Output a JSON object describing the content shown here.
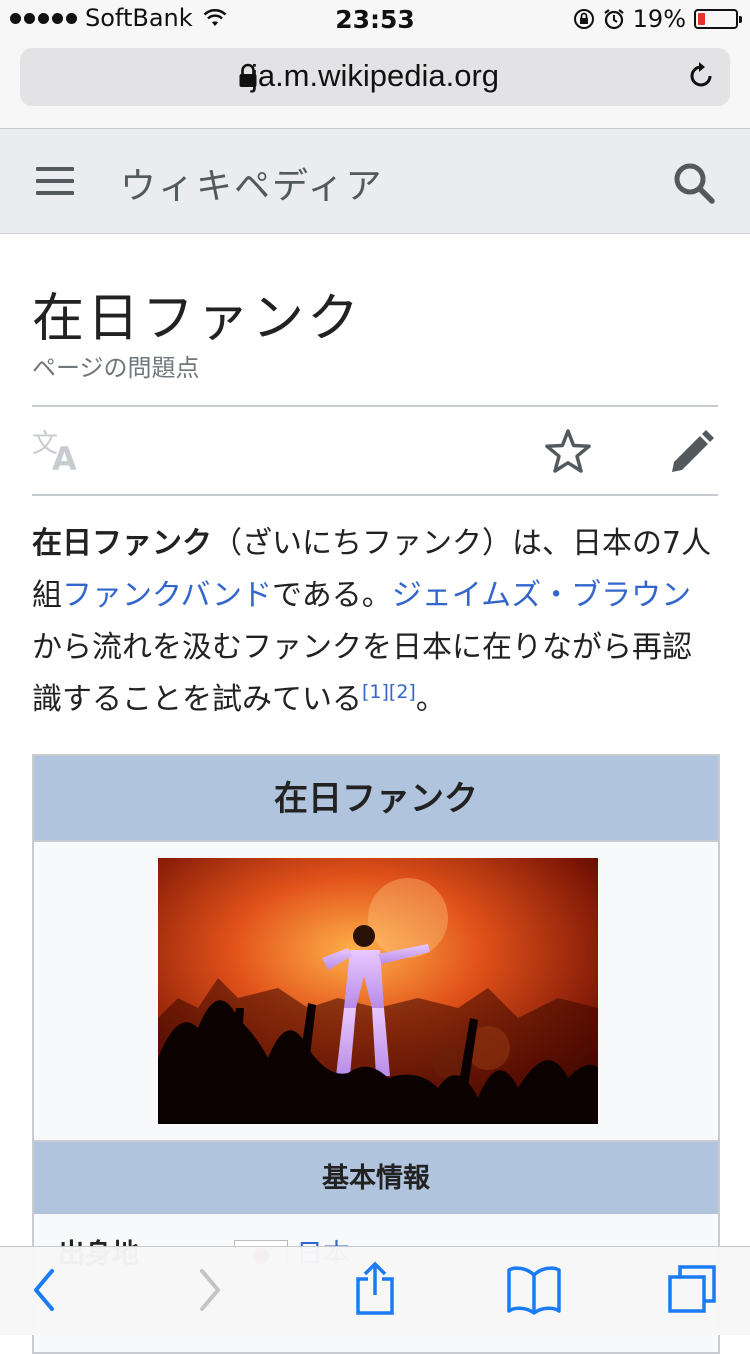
{
  "status_bar": {
    "carrier": "SoftBank",
    "time": "23:53",
    "battery_percent": "19%",
    "battery_level": 0.19,
    "battery_color": "#e8332c"
  },
  "browser": {
    "url": "ja.m.wikipedia.org",
    "lock_icon": "lock-icon",
    "reload_icon": "reload-icon"
  },
  "wiki_header": {
    "title": "ウィキペディア",
    "menu_icon": "hamburger-menu-icon",
    "search_icon": "search-icon"
  },
  "article": {
    "title": "在日ファンク",
    "issues_link": "ページの問題点",
    "actions": [
      "language-icon",
      "watch-star-icon",
      "edit-pencil-icon"
    ],
    "intro": {
      "bold": "在日ファンク",
      "t1": "（ざいにちファンク）は、日本の7人組",
      "link1": "ファンクバンド",
      "t2": "である。",
      "link2": "ジェイムズ・ブラウン",
      "t3": "から流れを汲むファンクを日本に在りながら再認識することを試みている",
      "ref1": "[1]",
      "ref2": "[2]",
      "t4": "。"
    }
  },
  "infobox": {
    "title": "在日ファンク",
    "subheader": "基本情報",
    "row_label": "出身地",
    "row_value": "日本",
    "header_color": "#b0c4de"
  },
  "toolbar": {
    "icons": [
      "back-icon",
      "forward-icon",
      "share-icon",
      "bookmarks-icon",
      "tabs-icon"
    ],
    "accent": "#1a7bf5"
  }
}
